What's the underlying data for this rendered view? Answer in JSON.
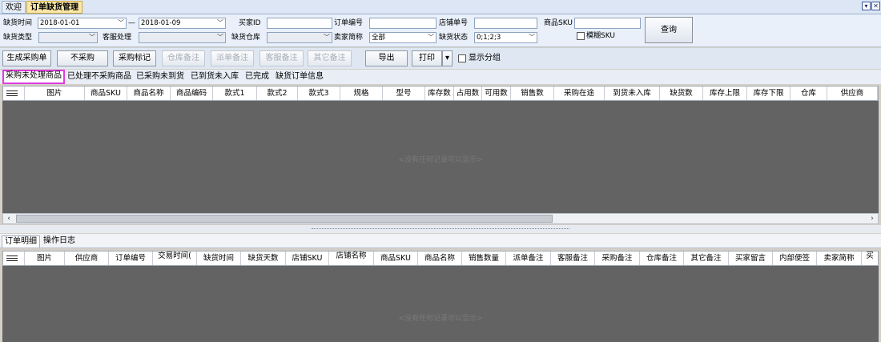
{
  "window": {
    "tabs": [
      "欢迎",
      "订单缺货管理"
    ],
    "active_tab": 1
  },
  "filters": {
    "lack_time_label": "缺货时间",
    "date_from": "2018-01-01",
    "date_sep": "—",
    "date_to": "2018-01-09",
    "buyer_id_label": "买家ID",
    "buyer_id_value": "",
    "order_no_label": "订单编号",
    "order_no_value": "",
    "shop_order_label": "店铺单号",
    "shop_order_value": "",
    "sku_label": "商品SKU",
    "sku_value": "",
    "fuzzy_sku_label": "模糊SKU",
    "query_label": "查询",
    "lack_type_label": "缺货类型",
    "lack_type_value": "",
    "cs_label": "客服处理",
    "cs_value": "",
    "warehouse_label": "缺货仓库",
    "warehouse_value": "",
    "seller_label": "卖家简称",
    "seller_value": "全部",
    "status_label": "缺货状态",
    "status_value": "0;1;2;3"
  },
  "toolbar": {
    "buttons": [
      "生成采购单",
      "不采购",
      "采购标记",
      "仓库备注",
      "派单备注",
      "客服备注",
      "其它备注",
      "导出",
      "打印"
    ],
    "show_group_label": "显示分组"
  },
  "status_tabs": [
    "采购未处理商品",
    "已处理不采购商品",
    "已采购未到货",
    "已到货未入库",
    "已完成",
    "缺货订单信息"
  ],
  "upper_grid": {
    "columns": [
      "图片",
      "商品SKU",
      "商品名称",
      "商品编码",
      "款式1",
      "款式2",
      "款式3",
      "规格",
      "型号",
      "库存数",
      "占用数",
      "可用数",
      "销售数",
      "采购在途",
      "到货未入库",
      "缺货数",
      "库存上限",
      "库存下限",
      "仓库",
      "供应商"
    ],
    "empty_text": "<没有任何记录可以显示>"
  },
  "lower_tabs": [
    "订单明细",
    "操作日志"
  ],
  "lower_grid": {
    "columns": [
      "图片",
      "供应商",
      "订单编号",
      "交易时间(",
      "缺货时间",
      "缺货天数",
      "店铺SKU",
      "店铺名称",
      "商品SKU",
      "商品名称",
      "销售数量",
      "派单备注",
      "客服备注",
      "采购备注",
      "仓库备注",
      "其它备注",
      "买家留言",
      "内部便签",
      "卖家简称",
      "买"
    ],
    "empty_text": "<没有任何记录可以显示>"
  }
}
